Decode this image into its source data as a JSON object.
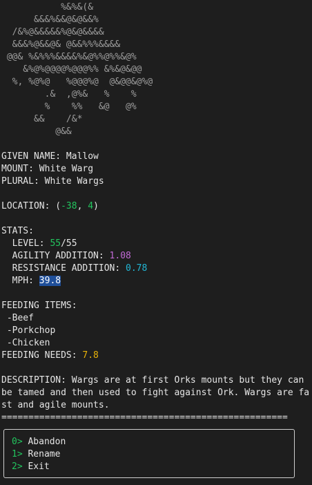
{
  "art": [
    "           %&%&(&",
    "      &&&%&&@&@&&%",
    "  /&%@&&&&&%@&@&&&&",
    "  &&&%@&&@& @&&%%%&&&&",
    " @@& %&%%%&&&&%&@%%@%%&@%",
    "    &%@%@@@@%@@@%% &%&@&@@",
    "  %, %@%@   %@@@%@  @&@@&@%@",
    "        .&  ,@%&   %    %",
    "        %    %%   &@   @%",
    "      &&    /&*",
    "          @&&"
  ],
  "fields": {
    "given_name_label": "GIVEN NAME: ",
    "given_name": "Mallow",
    "mount_label": "MOUNT: ",
    "mount": "White Warg",
    "plural_label": "PLURAL: ",
    "plural": "White Wargs"
  },
  "location": {
    "label": "LOCATION: ",
    "open": "(",
    "x": "-38",
    "sep": ", ",
    "y": "4",
    "close": ")"
  },
  "stats": {
    "header": "STATS:",
    "level_label": "  LEVEL: ",
    "level": "55",
    "level_max": "/55",
    "agility_label": "  AGILITY ADDITION: ",
    "agility": "1.08",
    "resistance_label": "  RESISTANCE ADDITION: ",
    "resistance": "0.78",
    "mph_label": "  MPH: ",
    "mph": "39.8"
  },
  "feeding": {
    "header": "FEEDING ITEMS:",
    "items": [
      " -Beef",
      " -Porkchop",
      " -Chicken"
    ],
    "needs_label": "FEEDING NEEDS: ",
    "needs": "7.8"
  },
  "description": {
    "text": "DESCRIPTION: Wargs are at first Orks mounts but they can be tamed and then used to fight against Ork. Wargs are fast and agile mounts."
  },
  "divider": "=====================================================",
  "menu": [
    {
      "key": "0>",
      "label": " Abandon"
    },
    {
      "key": "1>",
      "label": " Rename"
    },
    {
      "key": "2>",
      "label": " Exit"
    }
  ],
  "colors": {
    "green": "#22c55e",
    "yellow": "#eab308",
    "magenta": "#c26bd6",
    "cyan": "#22b8d6",
    "selection": "#1f4f9a"
  }
}
